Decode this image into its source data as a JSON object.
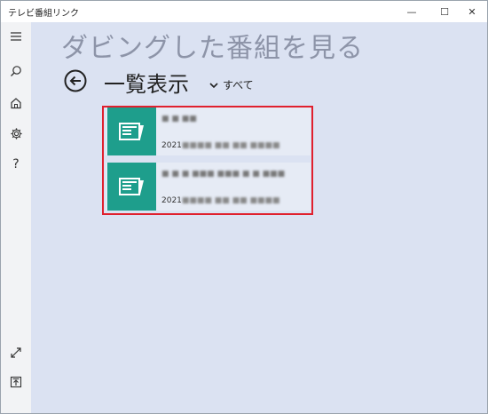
{
  "window": {
    "title": "テレビ番組リンク"
  },
  "window_controls": {
    "minimize": "—",
    "maximize": "☐",
    "close": "✕"
  },
  "sidebar": {
    "icons": [
      "menu-icon",
      "search-icon",
      "home-icon",
      "gear-icon",
      "help-icon",
      "expand-icon",
      "pin-to-top-icon"
    ],
    "help_glyph": "?"
  },
  "page": {
    "title": "ダビングした番組を見る"
  },
  "section": {
    "title": "一覧表示",
    "filter_label": "すべて"
  },
  "programs": [
    {
      "title": "■ ■ ■■",
      "date_prefix": "2021",
      "date_blurred": "■■■■ ■■ ■■ ■■■■"
    },
    {
      "title": "■ ■ ■ ■■■ ■■■ ■ ■ ■■■",
      "date_prefix": "2021",
      "date_blurred": "■■■■ ■■ ■■ ■■■■"
    }
  ],
  "colors": {
    "accent": "#1e9e8c",
    "highlight_border": "#e0202e",
    "background": "#dbe2f2"
  }
}
